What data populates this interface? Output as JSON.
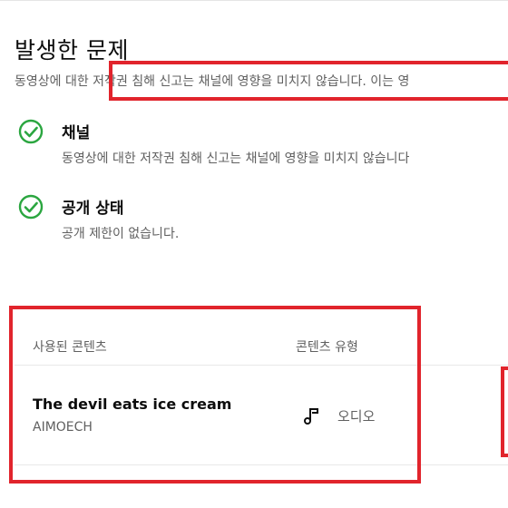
{
  "issues": {
    "title": "발생한 문제",
    "description": "동영상에 대한 저작권 침해 신고는 채널에 영향을 미치지 않습니다. 이는 영",
    "checks": [
      {
        "title": "채널",
        "description": "동영상에 대한 저작권 침해 신고는 채널에 영향을 미치지 않습니다",
        "icon": "check-circle-icon"
      },
      {
        "title": "공개 상태",
        "description": "공개 제한이 없습니다.",
        "icon": "check-circle-icon"
      }
    ]
  },
  "content_table": {
    "headers": {
      "content": "사용된 콘텐츠",
      "type": "콘텐츠 유형"
    },
    "rows": [
      {
        "title": "The devil eats ice cream",
        "artist": "AIMOECH",
        "type_icon": "music-note-icon",
        "type": "오디오"
      }
    ]
  },
  "colors": {
    "check_green": "#2ba640",
    "annotation_red": "#e1242c",
    "secondary_text": "#606060"
  }
}
